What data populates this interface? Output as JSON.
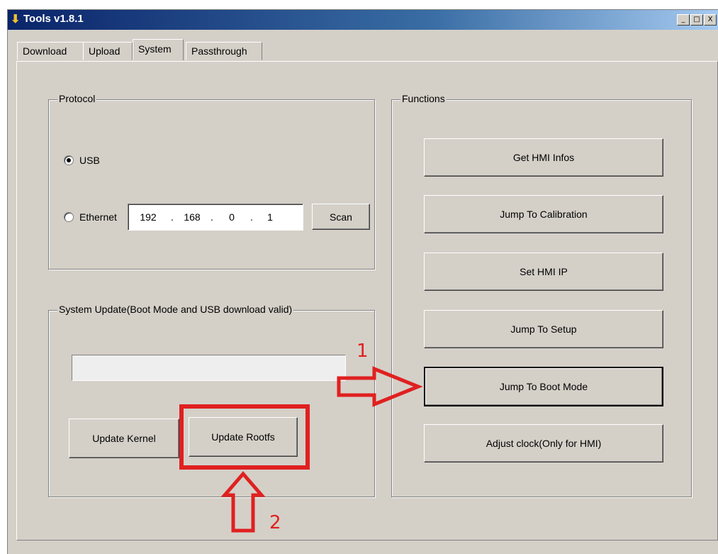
{
  "window": {
    "title": "Tools v1.8.1",
    "controls": [
      "_",
      "□",
      "X"
    ]
  },
  "tabs": [
    "Download",
    "Upload",
    "System",
    "Passthrough"
  ],
  "active_tab": "System",
  "protocol": {
    "legend": "Protocol",
    "usb_label": "USB",
    "ethernet_label": "Ethernet",
    "selected": "USB",
    "ip": [
      "192",
      "168",
      "0",
      "1"
    ],
    "scan_label": "Scan"
  },
  "system_update": {
    "legend": "System Update(Boot Mode and USB download valid)",
    "progress": 0,
    "update_kernel_label": "Update Kernel",
    "update_rootfs_label": "Update Rootfs"
  },
  "functions": {
    "legend": "Functions",
    "buttons": [
      "Get HMI Infos",
      "Jump To Calibration",
      "Set HMI IP",
      "Jump To Setup",
      "Jump To Boot Mode",
      "Adjust clock(Only for HMI)"
    ]
  },
  "annotations": {
    "step1": "1",
    "step2": "2",
    "color": "#e02020"
  }
}
